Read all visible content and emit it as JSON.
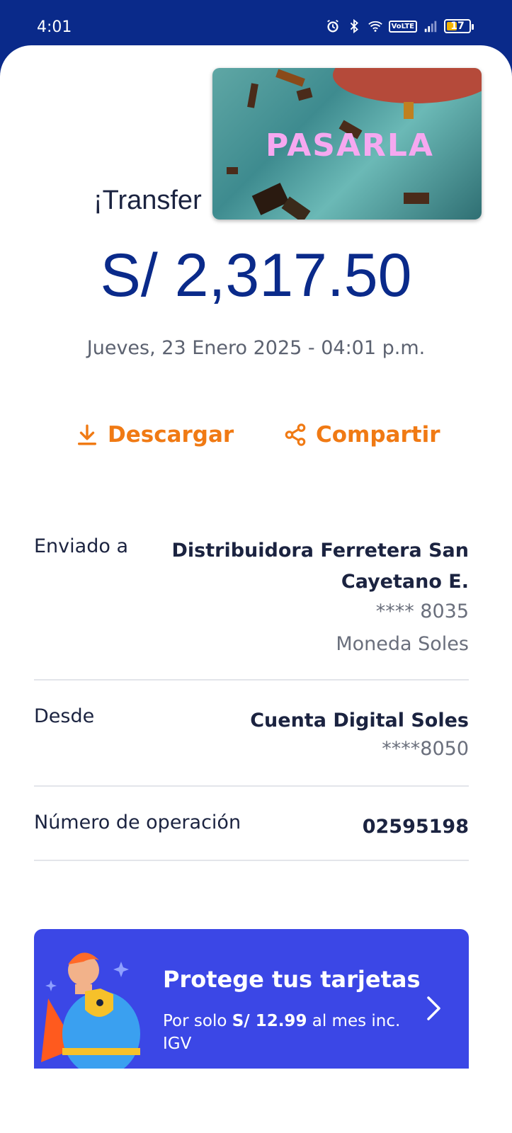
{
  "status_bar": {
    "time": "4:01",
    "volte": "VoLTE",
    "battery": "17"
  },
  "header": {
    "title_partial": "¡Transfer"
  },
  "pip_video": {
    "text": "PASARLA"
  },
  "transfer": {
    "amount": "S/ 2,317.50",
    "datetime": "Jueves, 23 Enero 2025 - 04:01 p.m."
  },
  "actions": {
    "download_label": "Descargar",
    "share_label": "Compartir"
  },
  "details": {
    "sent_to": {
      "label": "Enviado a",
      "name_line1": "Distribuidora Ferretera San",
      "name_line2": "Cayetano E.",
      "account": "**** 8035",
      "currency": "Moneda Soles"
    },
    "from": {
      "label": "Desde",
      "account_name": "Cuenta Digital Soles",
      "account_number": "****8050"
    },
    "operation": {
      "label": "Número de operación",
      "number": "02595198"
    }
  },
  "promo": {
    "title": "Protege tus tarjetas",
    "sub_prefix": "Por solo ",
    "sub_price": "S/ 12.99",
    "sub_suffix": " al mes inc. IGV"
  },
  "colors": {
    "brand_blue": "#0a2a8a",
    "accent_orange": "#f07a14",
    "promo_blue": "#3b47e6"
  }
}
